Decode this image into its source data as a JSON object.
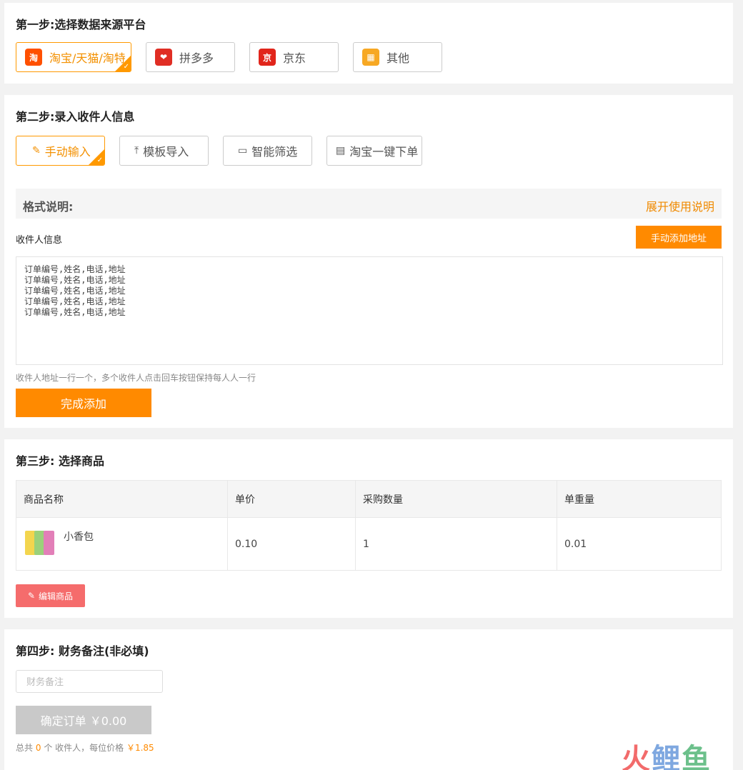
{
  "step1": {
    "title": "第一步:选择数据来源平台",
    "platforms": [
      {
        "label": "淘宝/天猫/淘特",
        "icon_glyph": "淘",
        "icon": "taobao-icon",
        "color": "#ff5000",
        "selected": true
      },
      {
        "label": "拼多多",
        "icon_glyph": "❤",
        "icon": "pinduoduo-icon",
        "color": "#e02e24",
        "selected": false
      },
      {
        "label": "京东",
        "icon_glyph": "京",
        "icon": "jd-icon",
        "color": "#e1251b",
        "selected": false
      },
      {
        "label": "其他",
        "icon_glyph": "▦",
        "icon": "grid-icon",
        "color": "#f7a823",
        "selected": false
      }
    ]
  },
  "step2": {
    "title": "第二步:录入收件人信息",
    "methods": [
      {
        "label": "手动输入",
        "icon_glyph": "✎",
        "icon": "pencil-icon",
        "selected": true
      },
      {
        "label": "模板导入",
        "icon_glyph": "⤒",
        "icon": "upload-icon",
        "selected": false
      },
      {
        "label": "智能筛选",
        "icon_glyph": "▭",
        "icon": "monitor-icon",
        "selected": false
      },
      {
        "label": "淘宝一键下单",
        "icon_glyph": "▤",
        "icon": "document-icon",
        "selected": false
      }
    ],
    "format_title": "格式说明:",
    "format_link": "展开使用说明",
    "recipient_label": "收件人信息",
    "add_address_button": "手动添加地址",
    "textarea_value": "订单编号,姓名,电话,地址\n订单编号,姓名,电话,地址\n订单编号,姓名,电话,地址\n订单编号,姓名,电话,地址\n订单编号,姓名,电话,地址",
    "hint": "收件人地址一行一个，多个收件人点击回车按钮保持每人人一行",
    "finish_button": "完成添加"
  },
  "step3": {
    "title": "第三步: 选择商品",
    "columns": [
      "商品名称",
      "单价",
      "采购数量",
      "单重量"
    ],
    "rows": [
      {
        "name": "小香包",
        "price": "0.10",
        "qty": "1",
        "weight": "0.01"
      }
    ],
    "edit_button": "编辑商品"
  },
  "step4": {
    "title": "第四步: 财务备注(非必填)",
    "note_placeholder": "财务备注",
    "confirm_button": "确定订单 ￥0.00",
    "summary_prefix": "总共",
    "summary_count": "0",
    "summary_middle": "个 收件人，每位价格",
    "summary_price": "￥1.85"
  },
  "watermark": {
    "c1": "火",
    "c2": "鲤",
    "c3": "鱼"
  },
  "colors": {
    "accent": "#ff8a00",
    "danger": "#f56c6c",
    "disabled": "#c9c9c9"
  }
}
